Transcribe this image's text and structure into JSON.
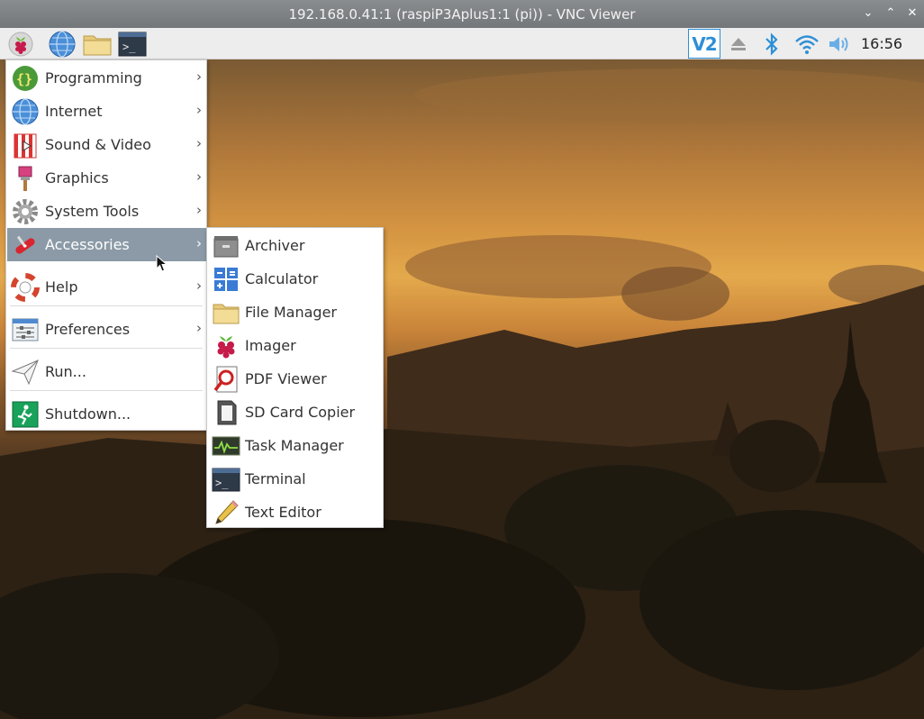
{
  "window": {
    "title": "192.168.0.41:1 (raspiP3Aplus1:1 (pi)) - VNC Viewer",
    "controls": {
      "minimize": "⌄",
      "maximize": "⌃",
      "close": "✕"
    }
  },
  "taskbar": {
    "launchers": [
      {
        "name": "raspberry-menu-icon"
      },
      {
        "name": "web-browser-icon"
      },
      {
        "name": "file-manager-icon"
      },
      {
        "name": "terminal-icon"
      }
    ],
    "tray": {
      "vnc_label": "V2",
      "clock": "16:56"
    }
  },
  "main_menu": {
    "items": [
      {
        "label": "Programming",
        "arrow": "›"
      },
      {
        "label": "Internet",
        "arrow": "›"
      },
      {
        "label": "Sound & Video",
        "arrow": "›"
      },
      {
        "label": "Graphics",
        "arrow": "›"
      },
      {
        "label": "System Tools",
        "arrow": "›"
      },
      {
        "label": "Accessories",
        "arrow": "›",
        "selected": true
      },
      {
        "label": "Help",
        "arrow": "›"
      },
      {
        "label": "Preferences",
        "arrow": "›"
      },
      {
        "label": "Run..."
      },
      {
        "label": "Shutdown..."
      }
    ]
  },
  "accessories_submenu": {
    "items": [
      {
        "label": "Archiver"
      },
      {
        "label": "Calculator"
      },
      {
        "label": "File Manager"
      },
      {
        "label": "Imager"
      },
      {
        "label": "PDF Viewer"
      },
      {
        "label": "SD Card Copier"
      },
      {
        "label": "Task Manager"
      },
      {
        "label": "Terminal"
      },
      {
        "label": "Text Editor"
      }
    ]
  },
  "colors": {
    "selection": "#8b9aa6",
    "accent_blue": "#2d8fd6",
    "raspberry": "#c51a4a"
  }
}
